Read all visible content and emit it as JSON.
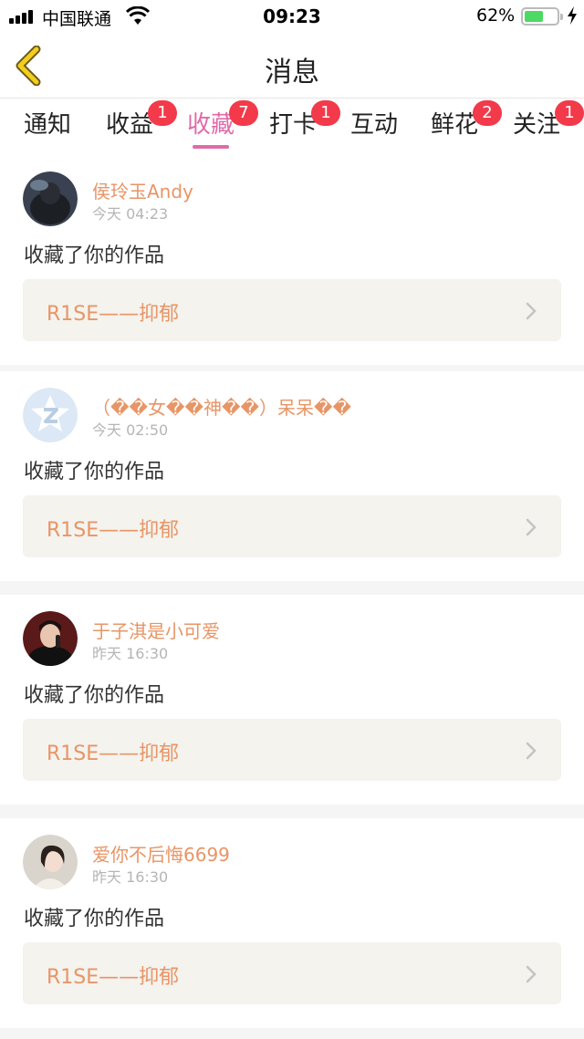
{
  "status": {
    "carrier": "中国联通",
    "time": "09:23",
    "battery_pct": "62%",
    "battery_level": 0.62
  },
  "nav": {
    "title": "消息"
  },
  "tabs": [
    {
      "label": "通知",
      "badge": null,
      "active": false
    },
    {
      "label": "收益",
      "badge": "1",
      "active": false
    },
    {
      "label": "收藏",
      "badge": "7",
      "active": true
    },
    {
      "label": "打卡",
      "badge": "1",
      "active": false
    },
    {
      "label": "互动",
      "badge": null,
      "active": false
    },
    {
      "label": "鲜花",
      "badge": "2",
      "active": false
    },
    {
      "label": "关注",
      "badge": "1",
      "active": false
    }
  ],
  "messages": [
    {
      "username": "侯玲玉Andy",
      "time": "今天 04:23",
      "action": "收藏了你的作品",
      "work": "R1SE——抑郁"
    },
    {
      "username": "（��女��神��）呆呆��",
      "time": "今天 02:50",
      "action": "收藏了你的作品",
      "work": "R1SE——抑郁"
    },
    {
      "username": "于子淇是小可爱",
      "time": "昨天 16:30",
      "action": "收藏了你的作品",
      "work": "R1SE——抑郁"
    },
    {
      "username": "爱你不后悔6699",
      "time": "昨天 16:30",
      "action": "收藏了你的作品",
      "work": "R1SE——抑郁"
    }
  ],
  "colors": {
    "accent_pink": "#e06aa8",
    "username_orange": "#e89566",
    "badge_red": "#f23a4a",
    "back_arrow_yellow": "#f2cf1f"
  }
}
